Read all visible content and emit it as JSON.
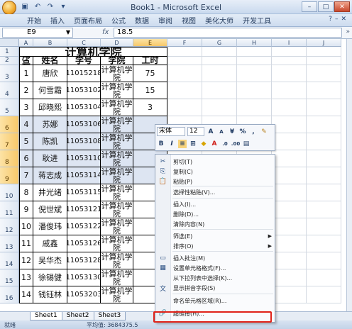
{
  "window": {
    "title": "Book1 - Microsoft Excel"
  },
  "ribbon": {
    "tabs": [
      "开始",
      "插入",
      "页面布局",
      "公式",
      "数据",
      "审阅",
      "视图",
      "美化大师",
      "开发工具"
    ]
  },
  "formula_bar": {
    "cell_ref": "E9",
    "fx": "fx",
    "value": "18.5"
  },
  "columns": [
    "A",
    "B",
    "C",
    "D",
    "E",
    "F",
    "G",
    "H",
    "I",
    "J"
  ],
  "rows": [
    "1",
    "2",
    "3",
    "4",
    "5",
    "6",
    "7",
    "8",
    "9",
    "10",
    "11",
    "12",
    "13",
    "14",
    "15",
    "16"
  ],
  "sheet": {
    "title": "计算机学院",
    "headers": [
      "序号",
      "姓名",
      "学号",
      "学院",
      "工时"
    ],
    "records": [
      [
        "1",
        "唐欣",
        "11015218",
        "计算机学院",
        "75"
      ],
      [
        "2",
        "何雪霜",
        "11053102",
        "计算机学院",
        "15"
      ],
      [
        "3",
        "邱晓熙",
        "11053104",
        "计算机学院",
        "3"
      ],
      [
        "4",
        "苏娜",
        "11053106",
        "计算机学院",
        ""
      ],
      [
        "5",
        "陈凯",
        "11053108",
        "计算机学院",
        ""
      ],
      [
        "6",
        "耿进",
        "11053110",
        "计算机学院",
        ""
      ],
      [
        "7",
        "蒋志成",
        "11053114",
        "计算机学院",
        ""
      ],
      [
        "8",
        "井光绪",
        "11053115",
        "计算机学院",
        ""
      ],
      [
        "9",
        "倪世斌",
        "11053121",
        "计算机学院",
        ""
      ],
      [
        "10",
        "潘俊玮",
        "11053122",
        "计算机学院",
        ""
      ],
      [
        "11",
        "戚鑫",
        "11053126",
        "计算机学院",
        ""
      ],
      [
        "12",
        "吴华杰",
        "11053128",
        "计算机学院",
        ""
      ],
      [
        "13",
        "徐锡健",
        "11053130",
        "计算机学院",
        ""
      ],
      [
        "14",
        "钱钰林",
        "11053203",
        "计算机学院",
        ""
      ]
    ]
  },
  "mini_toolbar": {
    "font": "宋体",
    "size": "12"
  },
  "context_menu": [
    {
      "label": "剪切(T)",
      "icon": "scissors-icon",
      "glyph": "✂"
    },
    {
      "label": "复制(C)",
      "icon": "copy-icon",
      "glyph": "⎘"
    },
    {
      "label": "粘贴(P)",
      "icon": "paste-icon",
      "glyph": "📋"
    },
    {
      "label": "选择性粘贴(V)...",
      "icon": "",
      "glyph": ""
    },
    {
      "label": "插入(I)...",
      "icon": "",
      "glyph": ""
    },
    {
      "label": "删除(D)...",
      "icon": "",
      "glyph": ""
    },
    {
      "label": "清除内容(N)",
      "icon": "",
      "glyph": ""
    },
    {
      "label": "筛选(E)",
      "icon": "",
      "glyph": "",
      "submenu": true
    },
    {
      "label": "排序(O)",
      "icon": "",
      "glyph": "",
      "submenu": true
    },
    {
      "label": "插入批注(M)",
      "icon": "comment-icon",
      "glyph": "▭"
    },
    {
      "label": "设置单元格格式(F)...",
      "icon": "format-cells-icon",
      "glyph": "▦"
    },
    {
      "label": "从下拉列表中选择(K)...",
      "icon": "",
      "glyph": ""
    },
    {
      "label": "显示拼音字段(S)",
      "icon": "phonetic-icon",
      "glyph": "文"
    },
    {
      "label": "命名单元格区域(R)...",
      "icon": "",
      "glyph": ""
    },
    {
      "label": "超链接(H)...",
      "icon": "hyperlink-icon",
      "glyph": "🔗"
    }
  ],
  "sheet_tabs": [
    "Sheet1",
    "Sheet2",
    "Sheet3"
  ],
  "status": {
    "mode": "就绪",
    "sum": "平均值: 3684375.5"
  }
}
